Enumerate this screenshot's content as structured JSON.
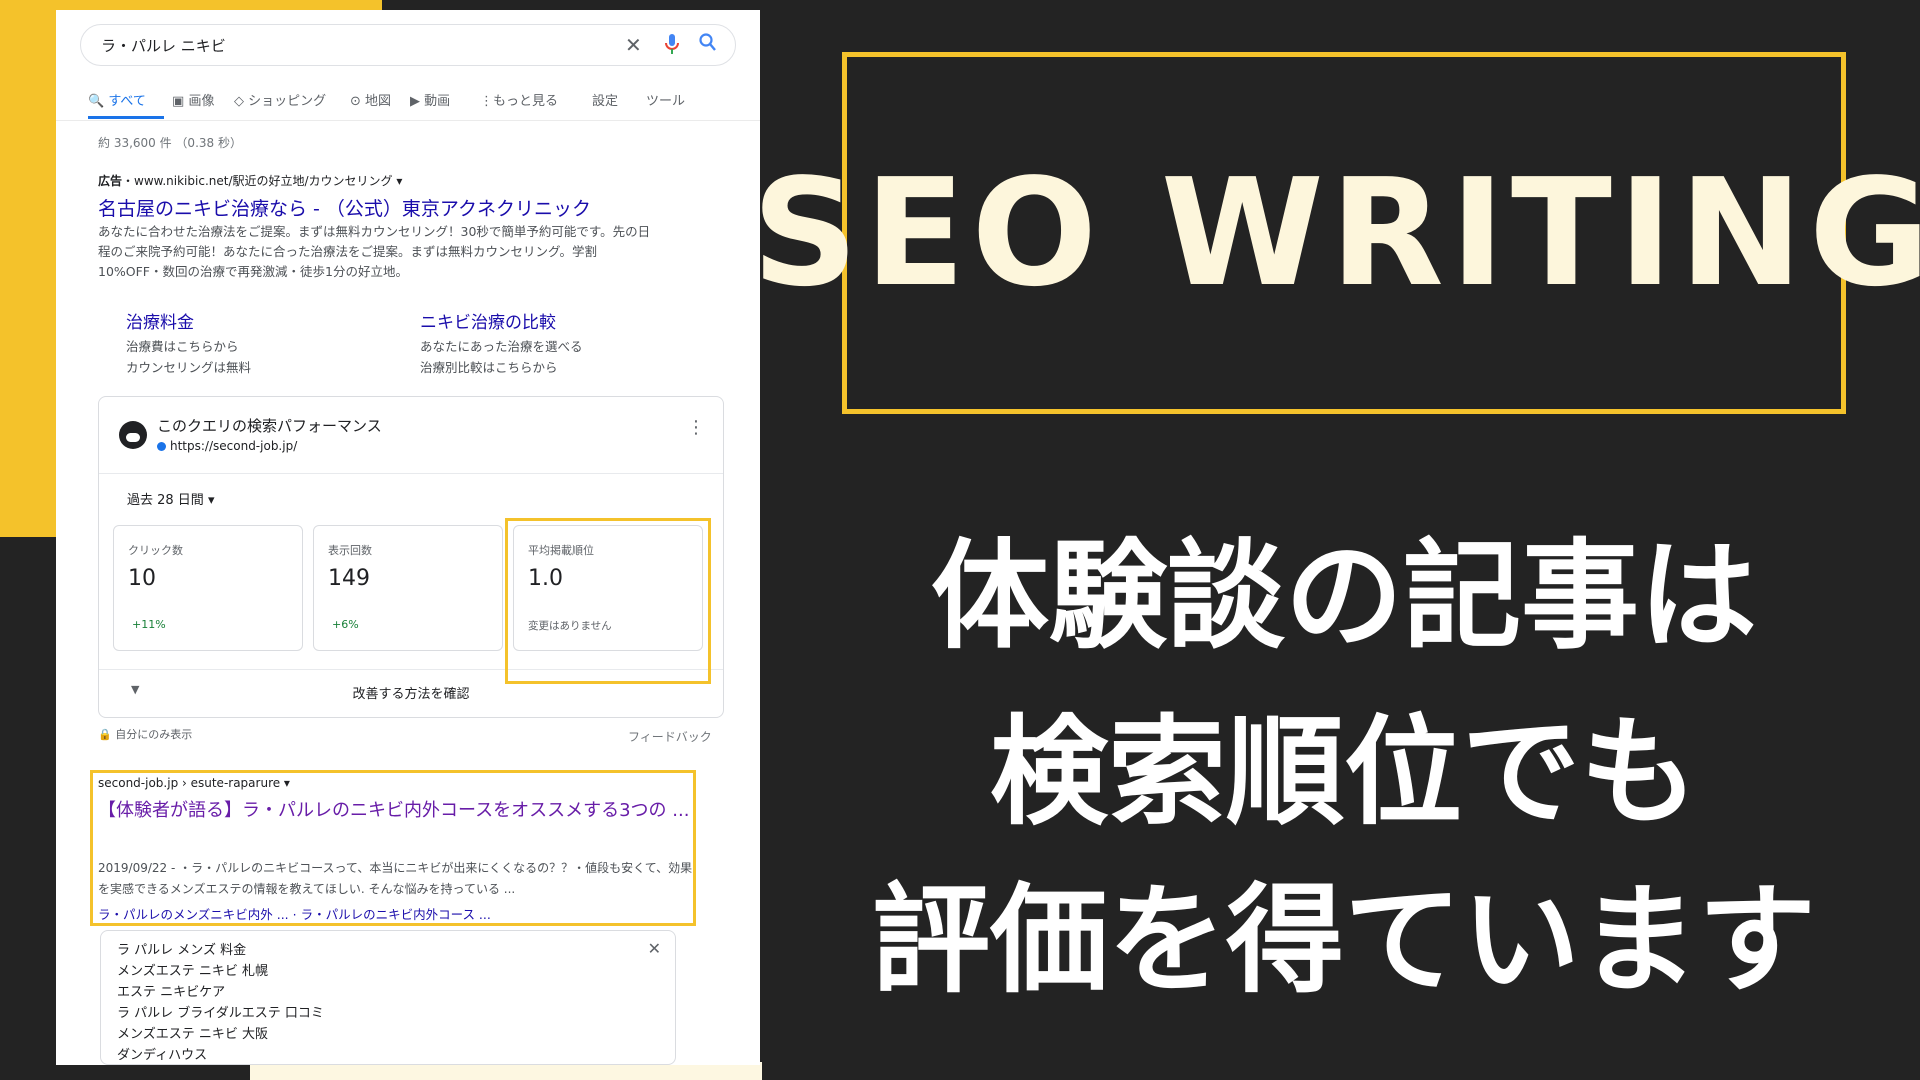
{
  "search": {
    "query": "ラ・パルレ ニキビ",
    "icons": [
      "close-icon",
      "mic-icon",
      "search-icon"
    ]
  },
  "tabs": [
    {
      "label": "すべて",
      "icon": "search-icon"
    },
    {
      "label": "画像",
      "icon": "image-icon"
    },
    {
      "label": "ショッピング",
      "icon": "tag-icon"
    },
    {
      "label": "地図",
      "icon": "pin-icon"
    },
    {
      "label": "動画",
      "icon": "play-icon"
    },
    {
      "label": "もっと見る",
      "icon": "more-vert-icon"
    },
    {
      "label": "設定"
    },
    {
      "label": "ツール"
    }
  ],
  "stats": "約 33,600 件 （0.38 秒）",
  "ad": {
    "badge": "広告",
    "url": "・www.nikibic.net/駅近の好立地/カウンセリング ▾",
    "title": "名古屋のニキビ治療なら - （公式）東京アクネクリニック",
    "desc": "あなたに合わせた治療法をご提案。まずは無料カウンセリング！30秒で簡単予約可能です。先の日程のご来院予約可能！あなたに合った治療法をご提案。まずは無料カウンセリング。学割10%OFF・数回の治療で再発激減・徒歩1分の好立地。",
    "sitelinks": [
      {
        "title": "治療料金",
        "lines": [
          "治療費はこちらから",
          "カウンセリングは無料"
        ]
      },
      {
        "title": "ニキビ治療の比較",
        "lines": [
          "あなたにあった治療を選べる",
          "治療別比較はこちらから"
        ]
      }
    ]
  },
  "performance": {
    "title": "このクエリの検索パフォーマンス",
    "url": "https://second-job.jp/",
    "period": "過去 28 日間 ▾",
    "metrics": [
      {
        "label": "クリック数",
        "value": "10",
        "change": "+11%"
      },
      {
        "label": "表示回数",
        "value": "149",
        "change": "+6%"
      },
      {
        "label": "平均掲載順位",
        "value": "1.0",
        "change": "変更はありません"
      }
    ],
    "improve": "改善する方法を確認",
    "private": "🔒 自分にのみ表示",
    "feedback": "フィードバック"
  },
  "result": {
    "crumb": "second-job.jp › esute-raparure ▾",
    "title": "【体験者が語る】ラ・パルレのニキビ内外コースをオススメする3つの ...",
    "snippet": "2019/09/22 - ・ラ・パルレのニキビコースって、本当にニキビが出来にくくなるの？？・値段も安くて、効果を実感できるメンズエステの情報を教えてほしい. そんな悩みを持っている ...",
    "links": "ラ・パルレのメンズニキビ内外 ... · ラ・パルレのニキビ内外コース ..."
  },
  "related": [
    "ラ パルレ メンズ 料金",
    "メンズエステ ニキビ 札幌",
    "エステ ニキビケア",
    "ラ パルレ ブライダルエステ 口コミ",
    "メンズエステ ニキビ 大阪",
    "ダンディハウス"
  ],
  "headline": "SEO WRITING",
  "message": [
    "体験談の記事は",
    "検索順位でも",
    "評価を得ています"
  ],
  "colors": {
    "accent": "#f4c22b",
    "background": "#232323",
    "cream": "#fdf6dc"
  }
}
